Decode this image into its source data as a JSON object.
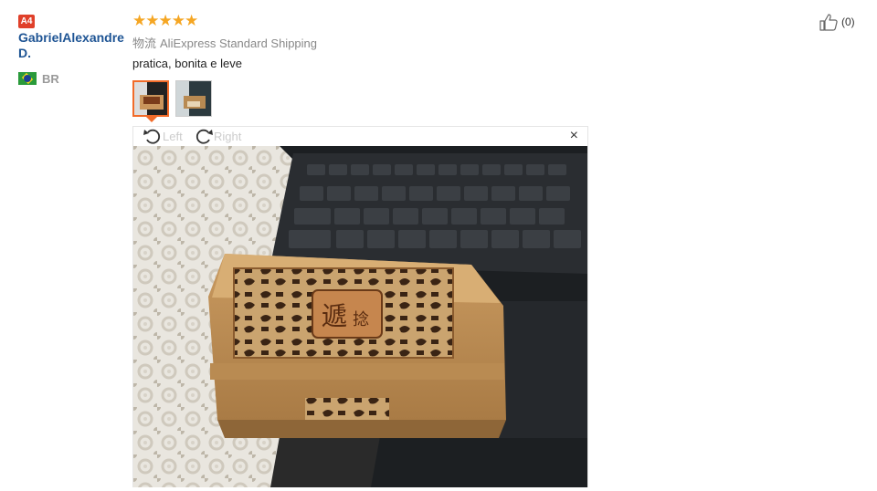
{
  "reviewer": {
    "level_badge": "A4",
    "name": "GabrielAlexandre D.",
    "country_code": "BR",
    "flag_icon": "brazil-flag-icon"
  },
  "review": {
    "rating": 5,
    "stars": "★★★★★",
    "logistics_label": "物流",
    "shipping": "AliExpress Standard Shipping",
    "text": "pratica, bonita e leve"
  },
  "like": {
    "count_label": "(0)",
    "icon": "thumbs-up-icon"
  },
  "viewer": {
    "rotate_left_label": "Left",
    "rotate_right_label": "Right",
    "close_label": "×"
  },
  "colors": {
    "star": "#f5a623",
    "username": "#1e5494",
    "selected_thumb_border": "#f26b29",
    "badge": "#e0402a"
  }
}
